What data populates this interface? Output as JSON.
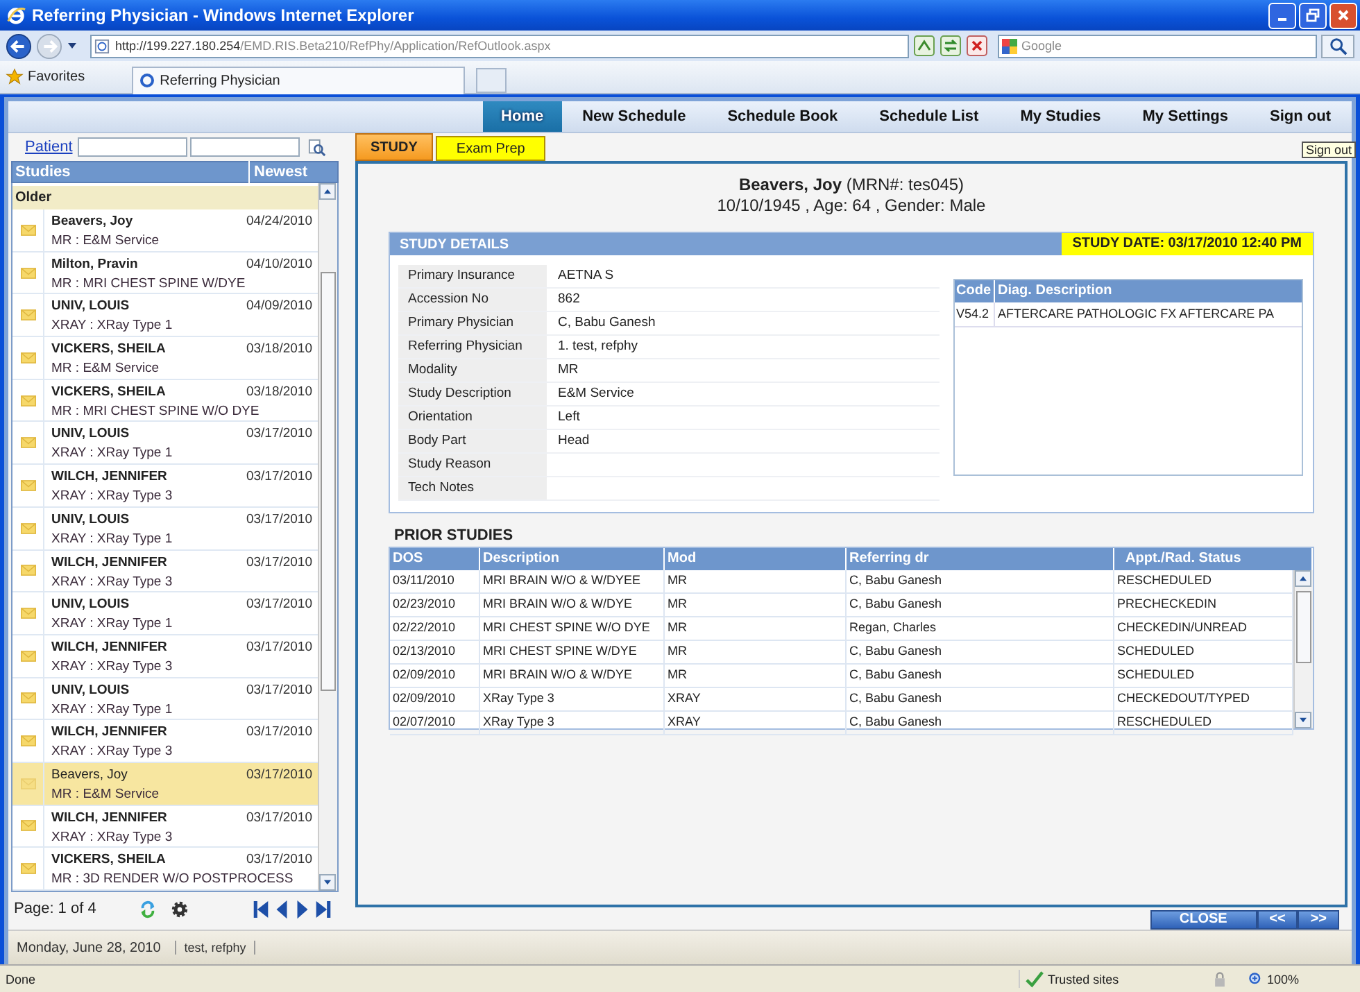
{
  "window": {
    "title": "Referring Physician - Windows Internet Explorer"
  },
  "browser": {
    "address_host": "http://199.227.180.254",
    "address_path": "/EMD.RIS.Beta210/RefPhy/Application/RefOutlook.aspx",
    "search_placeholder": "Google",
    "favorites": "Favorites",
    "tab": "Referring Physician"
  },
  "nav": [
    {
      "label": "Home",
      "selected": true
    },
    {
      "label": "New Schedule",
      "selected": false
    },
    {
      "label": "Schedule Book",
      "selected": false
    },
    {
      "label": "Schedule List",
      "selected": false
    },
    {
      "label": "My Studies",
      "selected": false
    },
    {
      "label": "My Settings",
      "selected": false
    },
    {
      "label": "Sign out",
      "selected": false
    }
  ],
  "tooltip": "Sign out",
  "patient_search": {
    "label": "Patient"
  },
  "studies": {
    "columns": [
      "Studies",
      "Newest"
    ],
    "group": "Older",
    "items": [
      {
        "name": "Beavers, Joy",
        "detail": "MR : E&M Service",
        "date": "04/24/2010",
        "unread": true,
        "selected": false
      },
      {
        "name": "Milton, Pravin",
        "detail": "MR : MRI CHEST SPINE W/DYE",
        "date": "04/10/2010",
        "unread": true,
        "selected": false
      },
      {
        "name": "UNIV, LOUIS",
        "detail": "XRAY : XRay Type 1",
        "date": "04/09/2010",
        "unread": true,
        "selected": false
      },
      {
        "name": "VICKERS, SHEILA",
        "detail": "MR : E&M Service",
        "date": "03/18/2010",
        "unread": true,
        "selected": false
      },
      {
        "name": "VICKERS, SHEILA",
        "detail": "MR : MRI CHEST SPINE W/O DYE",
        "date": "03/18/2010",
        "unread": true,
        "selected": false
      },
      {
        "name": "UNIV, LOUIS",
        "detail": "XRAY : XRay Type 1",
        "date": "03/17/2010",
        "unread": true,
        "selected": false
      },
      {
        "name": "WILCH, JENNIFER",
        "detail": "XRAY : XRay Type 3",
        "date": "03/17/2010",
        "unread": true,
        "selected": false
      },
      {
        "name": "UNIV, LOUIS",
        "detail": "XRAY : XRay Type 1",
        "date": "03/17/2010",
        "unread": true,
        "selected": false
      },
      {
        "name": "WILCH, JENNIFER",
        "detail": "XRAY : XRay Type 3",
        "date": "03/17/2010",
        "unread": true,
        "selected": false
      },
      {
        "name": "UNIV, LOUIS",
        "detail": "XRAY : XRay Type 1",
        "date": "03/17/2010",
        "unread": true,
        "selected": false
      },
      {
        "name": "WILCH, JENNIFER",
        "detail": "XRAY : XRay Type 3",
        "date": "03/17/2010",
        "unread": true,
        "selected": false
      },
      {
        "name": "UNIV, LOUIS",
        "detail": "XRAY : XRay Type 1",
        "date": "03/17/2010",
        "unread": true,
        "selected": false
      },
      {
        "name": "WILCH, JENNIFER",
        "detail": "XRAY : XRay Type 3",
        "date": "03/17/2010",
        "unread": true,
        "selected": false
      },
      {
        "name": "Beavers, Joy",
        "detail": "MR : E&M Service",
        "date": "03/17/2010",
        "unread": false,
        "selected": true
      },
      {
        "name": "WILCH, JENNIFER",
        "detail": "XRAY : XRay Type 3",
        "date": "03/17/2010",
        "unread": true,
        "selected": false
      },
      {
        "name": "VICKERS, SHEILA",
        "detail": "MR : 3D RENDER W/O POSTPROCESS",
        "date": "03/17/2010",
        "unread": true,
        "selected": false
      }
    ],
    "pager": "Page: 1 of 4"
  },
  "footer": {
    "date": "Monday, June 28, 2010",
    "user": "test, refphy"
  },
  "tabs": [
    {
      "label": "STUDY",
      "selected": true
    },
    {
      "label": "Exam Prep",
      "selected": false
    }
  ],
  "patient": {
    "name": "Beavers, Joy",
    "mrn": "(MRN#:  tes045)",
    "info": "10/10/1945 , Age: 64 , Gender: Male"
  },
  "study_details": {
    "title": "STUDY DETAILS",
    "study_date": "STUDY DATE: 03/17/2010 12:40 PM",
    "fields": [
      {
        "label": "Primary Insurance",
        "value": "AETNA S"
      },
      {
        "label": "Accession No",
        "value": "862"
      },
      {
        "label": "Primary Physician",
        "value": "C, Babu Ganesh"
      },
      {
        "label": "Referring Physician",
        "value": "1.   test, refphy"
      },
      {
        "label": "Modality",
        "value": "MR"
      },
      {
        "label": "Study Description",
        "value": "E&M Service"
      },
      {
        "label": "Orientation",
        "value": "Left"
      },
      {
        "label": "Body Part",
        "value": "Head"
      },
      {
        "label": "Study Reason"
      },
      {
        "label": "Tech Notes"
      }
    ],
    "diagnosis": {
      "columns": [
        "Code",
        "Diag. Description"
      ],
      "rows": [
        [
          "V54.2",
          "AFTERCARE PATHOLOGIC FX AFTERCARE PA"
        ]
      ]
    }
  },
  "prior_studies": {
    "title": "PRIOR STUDIES",
    "columns": [
      "DOS",
      "Description",
      "Mod",
      "Referring dr",
      "Appt./Rad. Status"
    ],
    "rows": [
      [
        "03/11/2010",
        "MRI BRAIN W/O & W/DYEE",
        "MR",
        "C, Babu Ganesh",
        "RESCHEDULED"
      ],
      [
        "02/23/2010",
        "MRI BRAIN W/O & W/DYE",
        "MR",
        "C, Babu Ganesh",
        "PRECHECKEDIN"
      ],
      [
        "02/22/2010",
        "MRI CHEST SPINE W/O DYE",
        "MR",
        "Regan, Charles",
        "CHECKEDIN/UNREAD"
      ],
      [
        "02/13/2010",
        "MRI CHEST SPINE W/DYE",
        "MR",
        "C, Babu Ganesh",
        "SCHEDULED"
      ],
      [
        "02/09/2010",
        "MRI BRAIN W/O & W/DYE",
        "MR",
        "C, Babu Ganesh",
        "SCHEDULED"
      ],
      [
        "02/09/2010",
        "XRay Type 3",
        "XRAY",
        "C, Babu Ganesh",
        "CHECKEDOUT/TYPED"
      ],
      [
        "02/07/2010",
        "XRay Type 3",
        "XRAY",
        "C, Babu Ganesh",
        "RESCHEDULED"
      ]
    ]
  },
  "buttons": {
    "close": "CLOSE",
    "prev": "<<",
    "next": ">>"
  },
  "status_bar": {
    "text": "Done",
    "zone": "Trusted sites",
    "zoom": "100%"
  }
}
